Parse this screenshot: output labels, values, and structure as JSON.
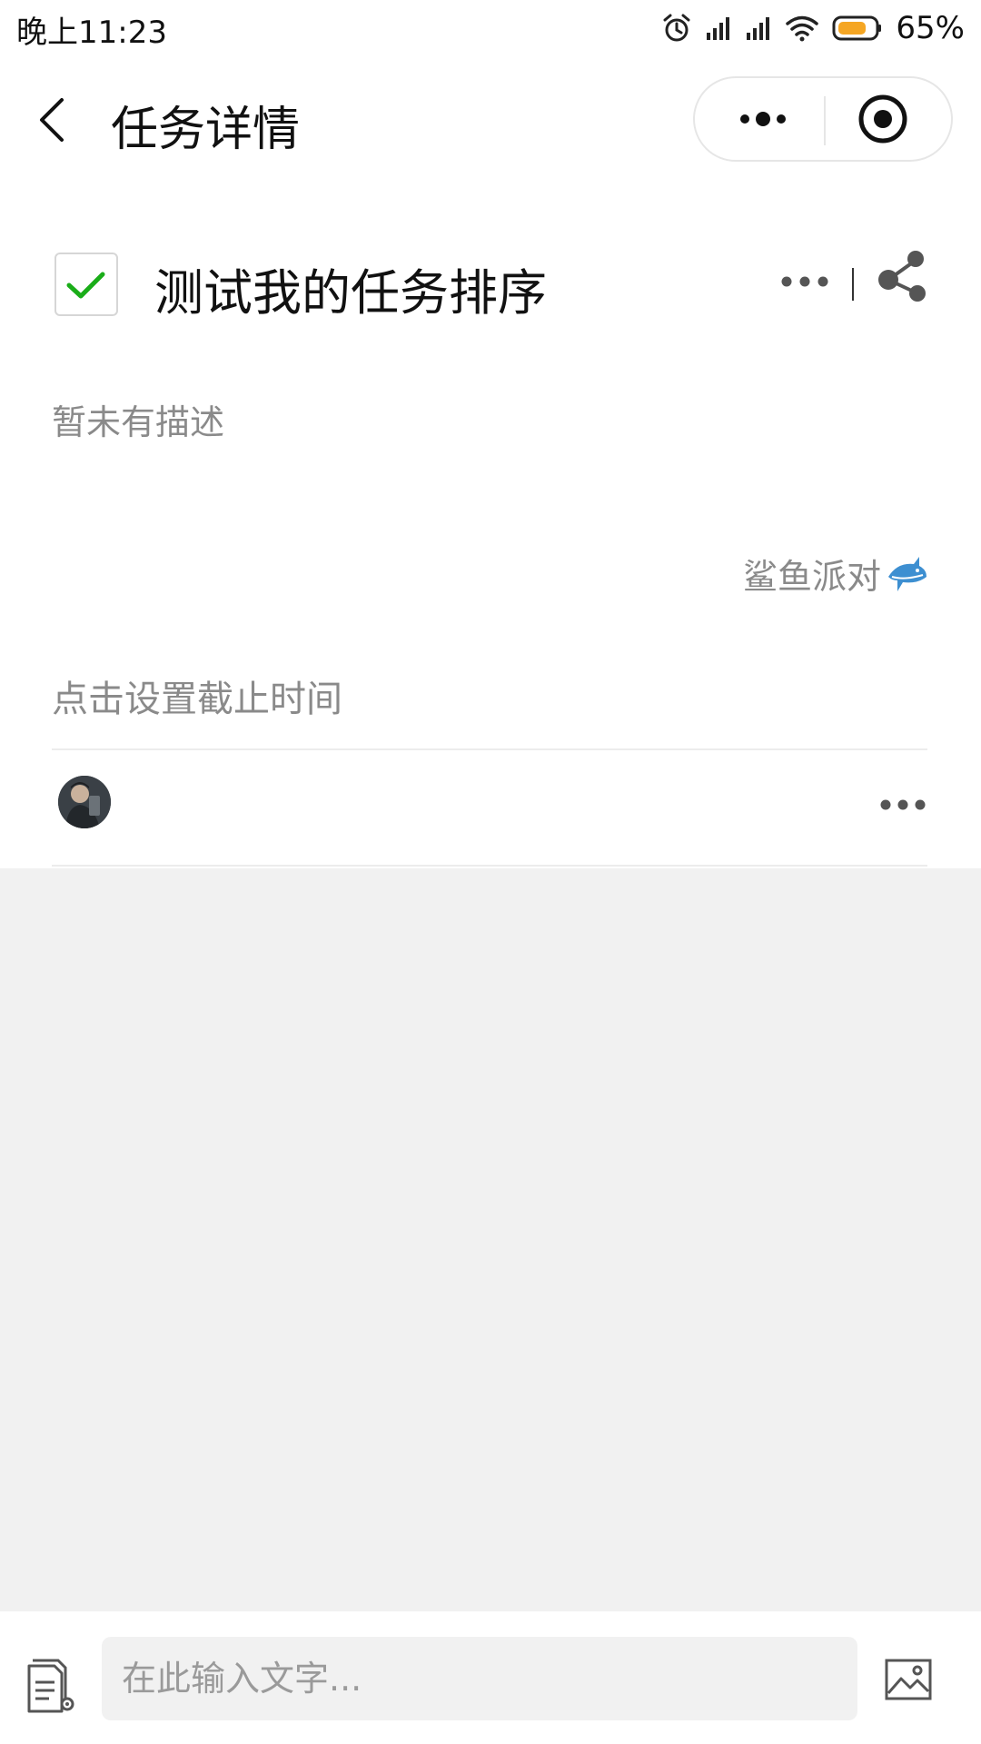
{
  "status_bar": {
    "time": "晚上11:23",
    "battery_percent": "65%",
    "icons": [
      "alarm-icon",
      "signal-icon",
      "signal-icon",
      "wifi-icon",
      "battery-icon"
    ],
    "battery_color": "#f5a623"
  },
  "nav": {
    "title": "任务详情",
    "icons": [
      "back-arrow-icon",
      "more-dots-icon",
      "close-target-icon"
    ]
  },
  "task": {
    "title": "测试我的任务排序",
    "checked": true,
    "check_color": "#1aad19",
    "description": "暂未有描述",
    "project_name": "鲨鱼派对",
    "project_icon": "shark-icon",
    "deadline": "点击设置截止时间"
  },
  "members": {
    "avatar_icon": "avatar",
    "more_icon": "more-dots-icon"
  },
  "input_bar": {
    "placeholder": "在此输入文字...",
    "left_icon": "document-settings-icon",
    "right_icon": "image-icon"
  },
  "colors": {
    "grey_background": "#f1f1f1",
    "muted_text": "#8a8a8a"
  }
}
